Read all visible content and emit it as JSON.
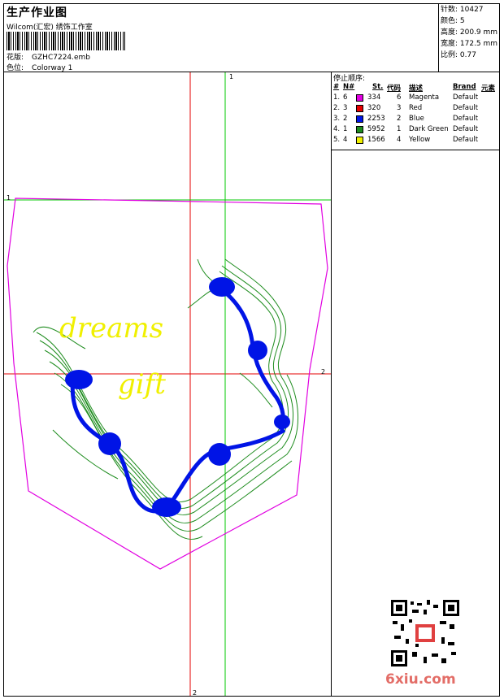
{
  "header": {
    "title": "生产作业图",
    "studio": "Wilcom(汇宏) 绣饰工作室",
    "design_label": "花版:",
    "design_value": "GZHC7224.emb",
    "colorway_label": "色位:",
    "colorway_value": "Colorway 1"
  },
  "stats": {
    "stitches": "针数: 10427",
    "colors": "颜色: 5",
    "height": "高度: 200.9 mm",
    "width": "宽度: 172.5 mm",
    "scale": "比例: 0.77"
  },
  "legend": {
    "title": "停止顺序:",
    "headers": {
      "num": "#",
      "needle": "N#",
      "st": "St.",
      "code": "代码",
      "desc": "描述",
      "brand": "Brand",
      "element": "元素"
    },
    "rows": [
      {
        "num": "1.",
        "needle": "6",
        "stitches": "334",
        "code": "6",
        "desc": "Magenta",
        "brand": "Default",
        "color": "#e100e1"
      },
      {
        "num": "2.",
        "needle": "3",
        "stitches": "320",
        "code": "3",
        "desc": "Red",
        "brand": "Default",
        "color": "#e60000"
      },
      {
        "num": "3.",
        "needle": "2",
        "stitches": "2253",
        "code": "2",
        "desc": "Blue",
        "brand": "Default",
        "color": "#0014e6"
      },
      {
        "num": "4.",
        "needle": "1",
        "stitches": "5952",
        "code": "1",
        "desc": "Dark Green",
        "brand": "Default",
        "color": "#1e8c1e"
      },
      {
        "num": "5.",
        "needle": "4",
        "stitches": "1566",
        "code": "4",
        "desc": "Yellow",
        "brand": "Default",
        "color": "#f0f000"
      }
    ]
  },
  "guides": {
    "green_v": "1",
    "green_h": "1",
    "red_h": "2",
    "red_v": "2"
  },
  "design_text": {
    "line1": "dreams",
    "line2": "gift"
  },
  "watermark": "6xiu.com"
}
